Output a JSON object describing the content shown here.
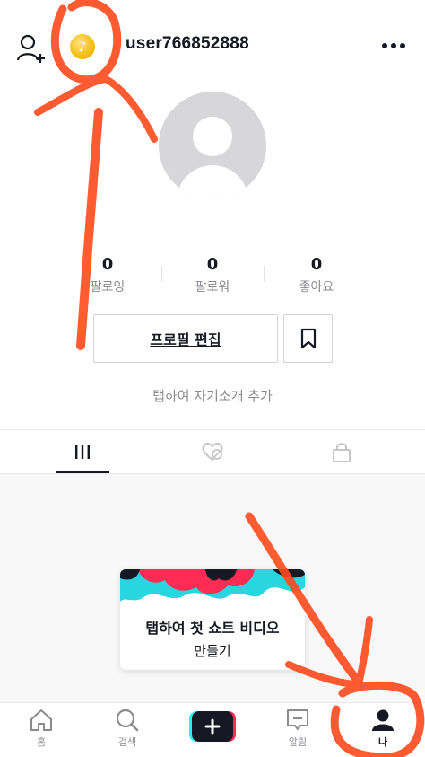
{
  "header": {
    "username": "user766852888",
    "coin_symbol": "♪"
  },
  "stats": [
    {
      "value": "0",
      "label": "팔로잉"
    },
    {
      "value": "0",
      "label": "팔로워"
    },
    {
      "value": "0",
      "label": "좋아요"
    }
  ],
  "buttons": {
    "edit_profile": "프로필 편집"
  },
  "bio_placeholder": "탭하여 자기소개 추가",
  "card": {
    "title": "탭하여 첫 쇼트 비디오",
    "subtitle": "만들기"
  },
  "nav": {
    "home": "홈",
    "search": "검색",
    "inbox": "알림",
    "me": "나"
  },
  "colors": {
    "annotation": "#ff4a1c",
    "text": "#161823",
    "muted": "#8a8b91",
    "coin": "#f2b705"
  }
}
